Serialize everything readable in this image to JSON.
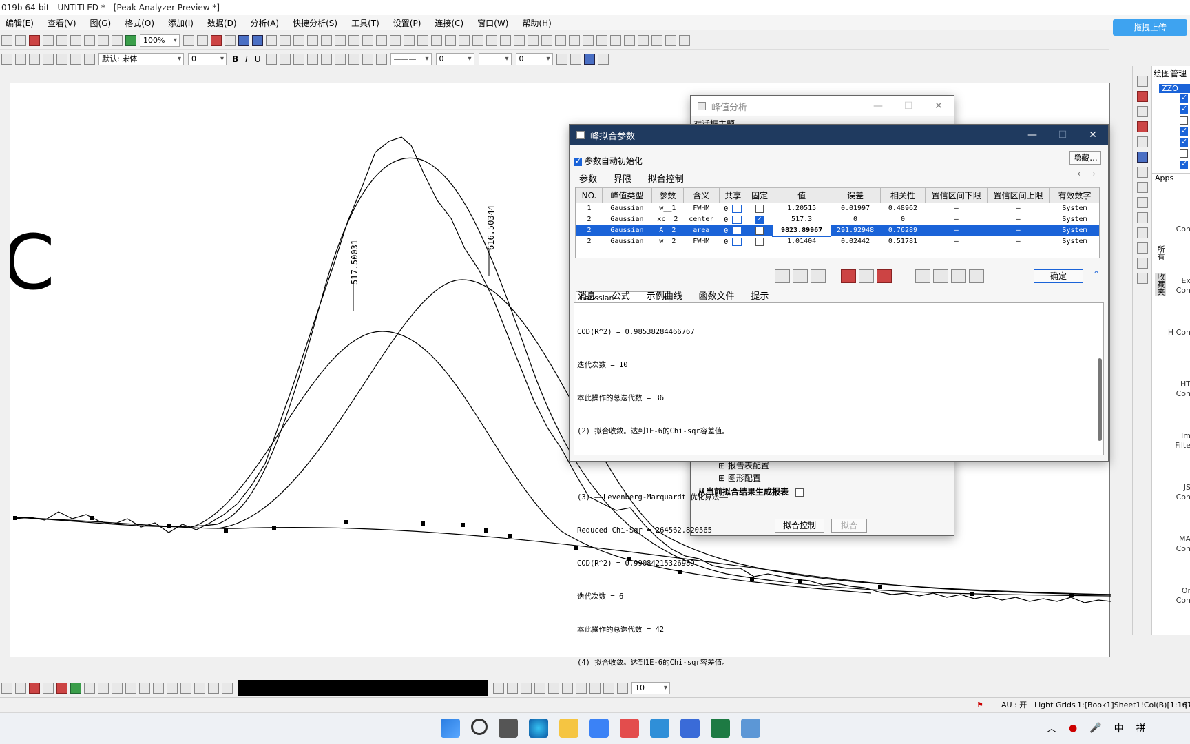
{
  "window": {
    "title": "019b 64-bit - UNTITLED * - [Peak Analyzer Preview *]"
  },
  "menu": [
    "编辑(E)",
    "查看(V)",
    "图(G)",
    "格式(O)",
    "添加(I)",
    "数据(D)",
    "分析(A)",
    "快捷分析(S)",
    "工具(T)",
    "设置(P)",
    "连接(C)",
    "窗口(W)",
    "帮助(H)"
  ],
  "toolbar": {
    "zoom": "100%",
    "font_name": "默认: 宋体",
    "font_size": "0",
    "line_style": "———",
    "field_a": "0",
    "field_b": "0",
    "bold": "B",
    "italic": "I",
    "underline": "U",
    "upload_label": "拖拽上传"
  },
  "graph": {
    "label_left": "C",
    "peak1_label": "517.50031",
    "peak2_label": "616.50344"
  },
  "peak_analysis_dialog": {
    "title": "峰值分析",
    "dialog_theme_label": "对话框主题",
    "tree_item_report": "报告表配置",
    "tree_item_graph": "图形配置",
    "report_label": "从当前拟合结果生成报表",
    "fit_control_button": "拟合控制",
    "fit_button": "拟合"
  },
  "fit_params_dialog": {
    "title": "峰拟合参数",
    "auto_init_label": "参数自动初始化",
    "hide_button": "隐藏...",
    "tabs": [
      "参数",
      "界限",
      "拟合控制"
    ],
    "columns": [
      "NO.",
      "峰值类型",
      "参数",
      "含义",
      "共享",
      "固定",
      "值",
      "误差",
      "相关性",
      "置信区间下限",
      "置信区间上限",
      "有效数字"
    ],
    "rows": [
      {
        "no": "1",
        "type": "Gaussian",
        "param": "w__1",
        "meaning": "FWHM",
        "share": "0",
        "fixed": false,
        "value": "1.20515",
        "error": "0.01997",
        "corr": "0.48962",
        "lcl": "—",
        "ucl": "—",
        "sig": "System"
      },
      {
        "no": "2",
        "type": "Gaussian",
        "param": "xc__2",
        "meaning": "center",
        "share": "0",
        "fixed": true,
        "value": "517.3",
        "error": "0",
        "corr": "0",
        "lcl": "—",
        "ucl": "—",
        "sig": "System"
      },
      {
        "no": "2",
        "type": "Gaussian",
        "param": "A__2",
        "meaning": "area",
        "share": "0",
        "fixed": false,
        "value": "9823.89967",
        "error": "291.92948",
        "corr": "0.76289",
        "lcl": "—",
        "ucl": "—",
        "sig": "System",
        "selected": true
      },
      {
        "no": "2",
        "type": "Gaussian",
        "param": "w__2",
        "meaning": "FWHM",
        "share": "0",
        "fixed": false,
        "value": "1.01404",
        "error": "0.02442",
        "corr": "0.51781",
        "lcl": "—",
        "ucl": "—",
        "sig": "System"
      }
    ],
    "function_select": "Gaussian",
    "ok_button": "确定",
    "lower_tabs": [
      "消息",
      "公式",
      "示例曲线",
      "函数文件",
      "提示"
    ],
    "log": [
      "COD(R^2) = 0.98538284466767",
      "迭代次数 = 10",
      "本此操作的总迭代数 = 36",
      "(2) 拟合收敛。达到1E-6的Chi-sqr容差值。",
      "",
      "(3) ——Levenberg-Marquardt 优化算法——",
      "Reduced Chi-Sqr = 264562.820565",
      "COD(R^2) = 0.99084215326989",
      "迭代次数 = 6",
      "本此操作的总迭代数 = 42",
      "(4) 拟合收敛。达到1E-6的Chi-sqr容差值。"
    ]
  },
  "right_panel": {
    "title": "绘图管理",
    "tree_root": "ZZO",
    "apps_label": "Apps",
    "side_tab_all": "所有",
    "side_tab_fav": "收藏夹",
    "apps": [
      "Con",
      "Ex Con",
      "H Con",
      "HT Con",
      "Im Filte",
      "JS Con",
      "MA Con",
      "Or Con"
    ]
  },
  "status": {
    "au": "AU : 开",
    "grids": "Light Grids",
    "cell": "1:[Book1]Sheet1!Col(B)[1:161]",
    "extra": "1:[2",
    "bottom_field": "10"
  },
  "taskbar": {
    "lang": "中",
    "ime": "拼"
  }
}
